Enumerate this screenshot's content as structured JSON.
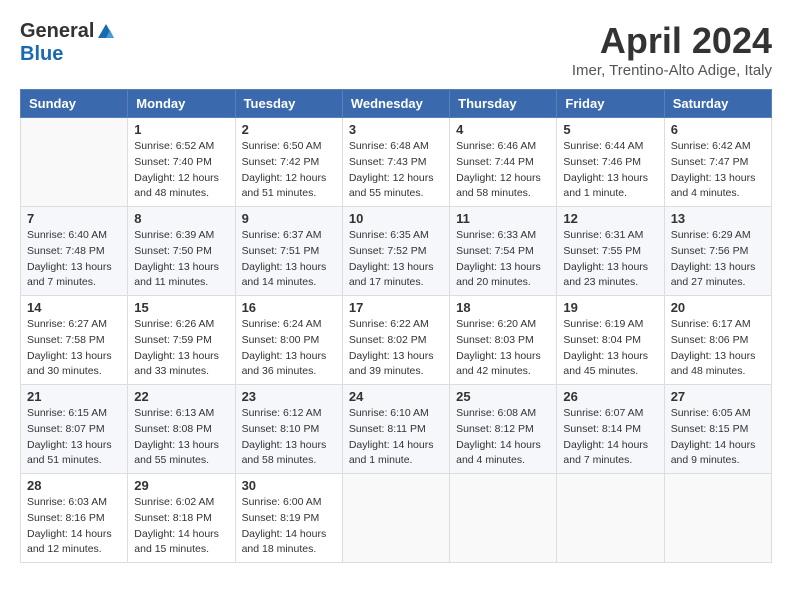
{
  "header": {
    "logo_general": "General",
    "logo_blue": "Blue",
    "title": "April 2024",
    "subtitle": "Imer, Trentino-Alto Adige, Italy"
  },
  "columns": [
    "Sunday",
    "Monday",
    "Tuesday",
    "Wednesday",
    "Thursday",
    "Friday",
    "Saturday"
  ],
  "weeks": [
    [
      {
        "day": "",
        "info": ""
      },
      {
        "day": "1",
        "info": "Sunrise: 6:52 AM\nSunset: 7:40 PM\nDaylight: 12 hours\nand 48 minutes."
      },
      {
        "day": "2",
        "info": "Sunrise: 6:50 AM\nSunset: 7:42 PM\nDaylight: 12 hours\nand 51 minutes."
      },
      {
        "day": "3",
        "info": "Sunrise: 6:48 AM\nSunset: 7:43 PM\nDaylight: 12 hours\nand 55 minutes."
      },
      {
        "day": "4",
        "info": "Sunrise: 6:46 AM\nSunset: 7:44 PM\nDaylight: 12 hours\nand 58 minutes."
      },
      {
        "day": "5",
        "info": "Sunrise: 6:44 AM\nSunset: 7:46 PM\nDaylight: 13 hours\nand 1 minute."
      },
      {
        "day": "6",
        "info": "Sunrise: 6:42 AM\nSunset: 7:47 PM\nDaylight: 13 hours\nand 4 minutes."
      }
    ],
    [
      {
        "day": "7",
        "info": "Sunrise: 6:40 AM\nSunset: 7:48 PM\nDaylight: 13 hours\nand 7 minutes."
      },
      {
        "day": "8",
        "info": "Sunrise: 6:39 AM\nSunset: 7:50 PM\nDaylight: 13 hours\nand 11 minutes."
      },
      {
        "day": "9",
        "info": "Sunrise: 6:37 AM\nSunset: 7:51 PM\nDaylight: 13 hours\nand 14 minutes."
      },
      {
        "day": "10",
        "info": "Sunrise: 6:35 AM\nSunset: 7:52 PM\nDaylight: 13 hours\nand 17 minutes."
      },
      {
        "day": "11",
        "info": "Sunrise: 6:33 AM\nSunset: 7:54 PM\nDaylight: 13 hours\nand 20 minutes."
      },
      {
        "day": "12",
        "info": "Sunrise: 6:31 AM\nSunset: 7:55 PM\nDaylight: 13 hours\nand 23 minutes."
      },
      {
        "day": "13",
        "info": "Sunrise: 6:29 AM\nSunset: 7:56 PM\nDaylight: 13 hours\nand 27 minutes."
      }
    ],
    [
      {
        "day": "14",
        "info": "Sunrise: 6:27 AM\nSunset: 7:58 PM\nDaylight: 13 hours\nand 30 minutes."
      },
      {
        "day": "15",
        "info": "Sunrise: 6:26 AM\nSunset: 7:59 PM\nDaylight: 13 hours\nand 33 minutes."
      },
      {
        "day": "16",
        "info": "Sunrise: 6:24 AM\nSunset: 8:00 PM\nDaylight: 13 hours\nand 36 minutes."
      },
      {
        "day": "17",
        "info": "Sunrise: 6:22 AM\nSunset: 8:02 PM\nDaylight: 13 hours\nand 39 minutes."
      },
      {
        "day": "18",
        "info": "Sunrise: 6:20 AM\nSunset: 8:03 PM\nDaylight: 13 hours\nand 42 minutes."
      },
      {
        "day": "19",
        "info": "Sunrise: 6:19 AM\nSunset: 8:04 PM\nDaylight: 13 hours\nand 45 minutes."
      },
      {
        "day": "20",
        "info": "Sunrise: 6:17 AM\nSunset: 8:06 PM\nDaylight: 13 hours\nand 48 minutes."
      }
    ],
    [
      {
        "day": "21",
        "info": "Sunrise: 6:15 AM\nSunset: 8:07 PM\nDaylight: 13 hours\nand 51 minutes."
      },
      {
        "day": "22",
        "info": "Sunrise: 6:13 AM\nSunset: 8:08 PM\nDaylight: 13 hours\nand 55 minutes."
      },
      {
        "day": "23",
        "info": "Sunrise: 6:12 AM\nSunset: 8:10 PM\nDaylight: 13 hours\nand 58 minutes."
      },
      {
        "day": "24",
        "info": "Sunrise: 6:10 AM\nSunset: 8:11 PM\nDaylight: 14 hours\nand 1 minute."
      },
      {
        "day": "25",
        "info": "Sunrise: 6:08 AM\nSunset: 8:12 PM\nDaylight: 14 hours\nand 4 minutes."
      },
      {
        "day": "26",
        "info": "Sunrise: 6:07 AM\nSunset: 8:14 PM\nDaylight: 14 hours\nand 7 minutes."
      },
      {
        "day": "27",
        "info": "Sunrise: 6:05 AM\nSunset: 8:15 PM\nDaylight: 14 hours\nand 9 minutes."
      }
    ],
    [
      {
        "day": "28",
        "info": "Sunrise: 6:03 AM\nSunset: 8:16 PM\nDaylight: 14 hours\nand 12 minutes."
      },
      {
        "day": "29",
        "info": "Sunrise: 6:02 AM\nSunset: 8:18 PM\nDaylight: 14 hours\nand 15 minutes."
      },
      {
        "day": "30",
        "info": "Sunrise: 6:00 AM\nSunset: 8:19 PM\nDaylight: 14 hours\nand 18 minutes."
      },
      {
        "day": "",
        "info": ""
      },
      {
        "day": "",
        "info": ""
      },
      {
        "day": "",
        "info": ""
      },
      {
        "day": "",
        "info": ""
      }
    ]
  ]
}
